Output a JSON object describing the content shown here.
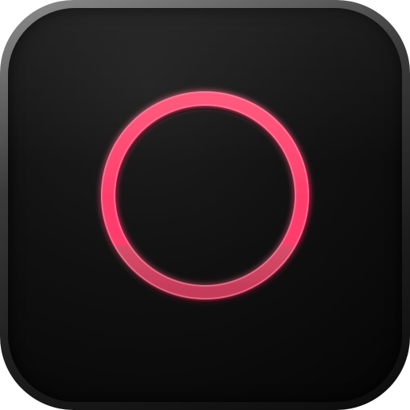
{
  "app_icon": {
    "icon_name": "record-ring-icon",
    "colors": {
      "background": "#0d0d0d",
      "frame_light": "#8f8f8f",
      "ring_primary": "#ff3e6c",
      "ring_highlight": "#ff7a98",
      "ring_shadow": "#c53a59"
    }
  }
}
